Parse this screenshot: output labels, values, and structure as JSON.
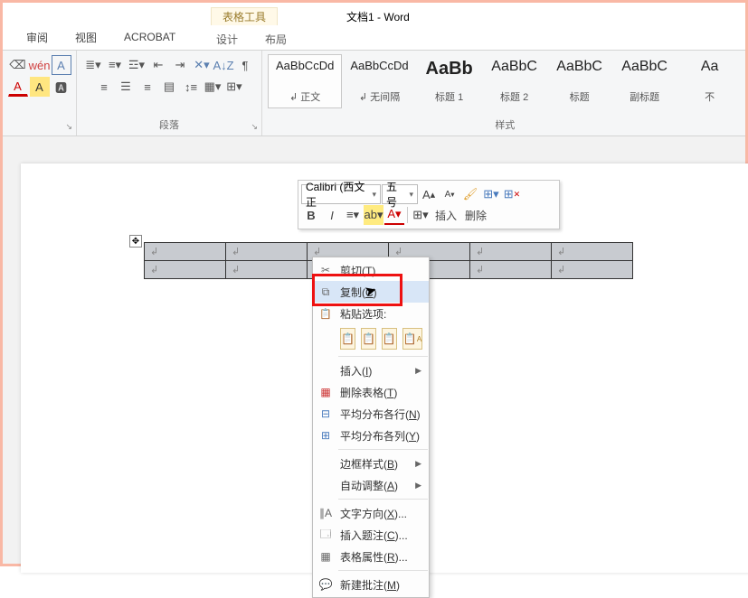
{
  "title_tool": "表格工具",
  "doc_title": "文档1 - Word",
  "tabs": {
    "review": "审阅",
    "view": "视图",
    "acrobat": "ACROBAT",
    "design": "设计",
    "layout": "布局"
  },
  "ribbon": {
    "paragraph_label": "段落",
    "styles_label": "样式",
    "styles": [
      {
        "preview": "AaBbCcDd",
        "caption": "↲ 正文",
        "cls": "selected"
      },
      {
        "preview": "AaBbCcDd",
        "caption": "↲ 无间隔",
        "cls": ""
      },
      {
        "preview": "AaBb",
        "caption": "标题 1",
        "cls": "big"
      },
      {
        "preview": "AaBbC",
        "caption": "标题 2",
        "cls": "mid"
      },
      {
        "preview": "AaBbC",
        "caption": "标题",
        "cls": "mid"
      },
      {
        "preview": "AaBbC",
        "caption": "副标题",
        "cls": "mid"
      },
      {
        "preview": "Aa",
        "caption": "不",
        "cls": "mid"
      }
    ]
  },
  "minitb": {
    "font": "Calibri (西文正",
    "size": "五号",
    "insert": "插入",
    "delete": "删除"
  },
  "ctx": {
    "cut": "剪切(T)",
    "copy": "复制(C)",
    "pasteopts": "粘贴选项:",
    "insert": "插入(I)",
    "del_table": "删除表格(T)",
    "dist_rows": "平均分布各行(N)",
    "dist_cols": "平均分布各列(Y)",
    "border_style": "边框样式(B)",
    "autofit": "自动调整(A)",
    "text_dir": "文字方向(X)...",
    "caption": "插入题注(C)...",
    "props": "表格属性(R)...",
    "comment": "新建批注(M)"
  }
}
